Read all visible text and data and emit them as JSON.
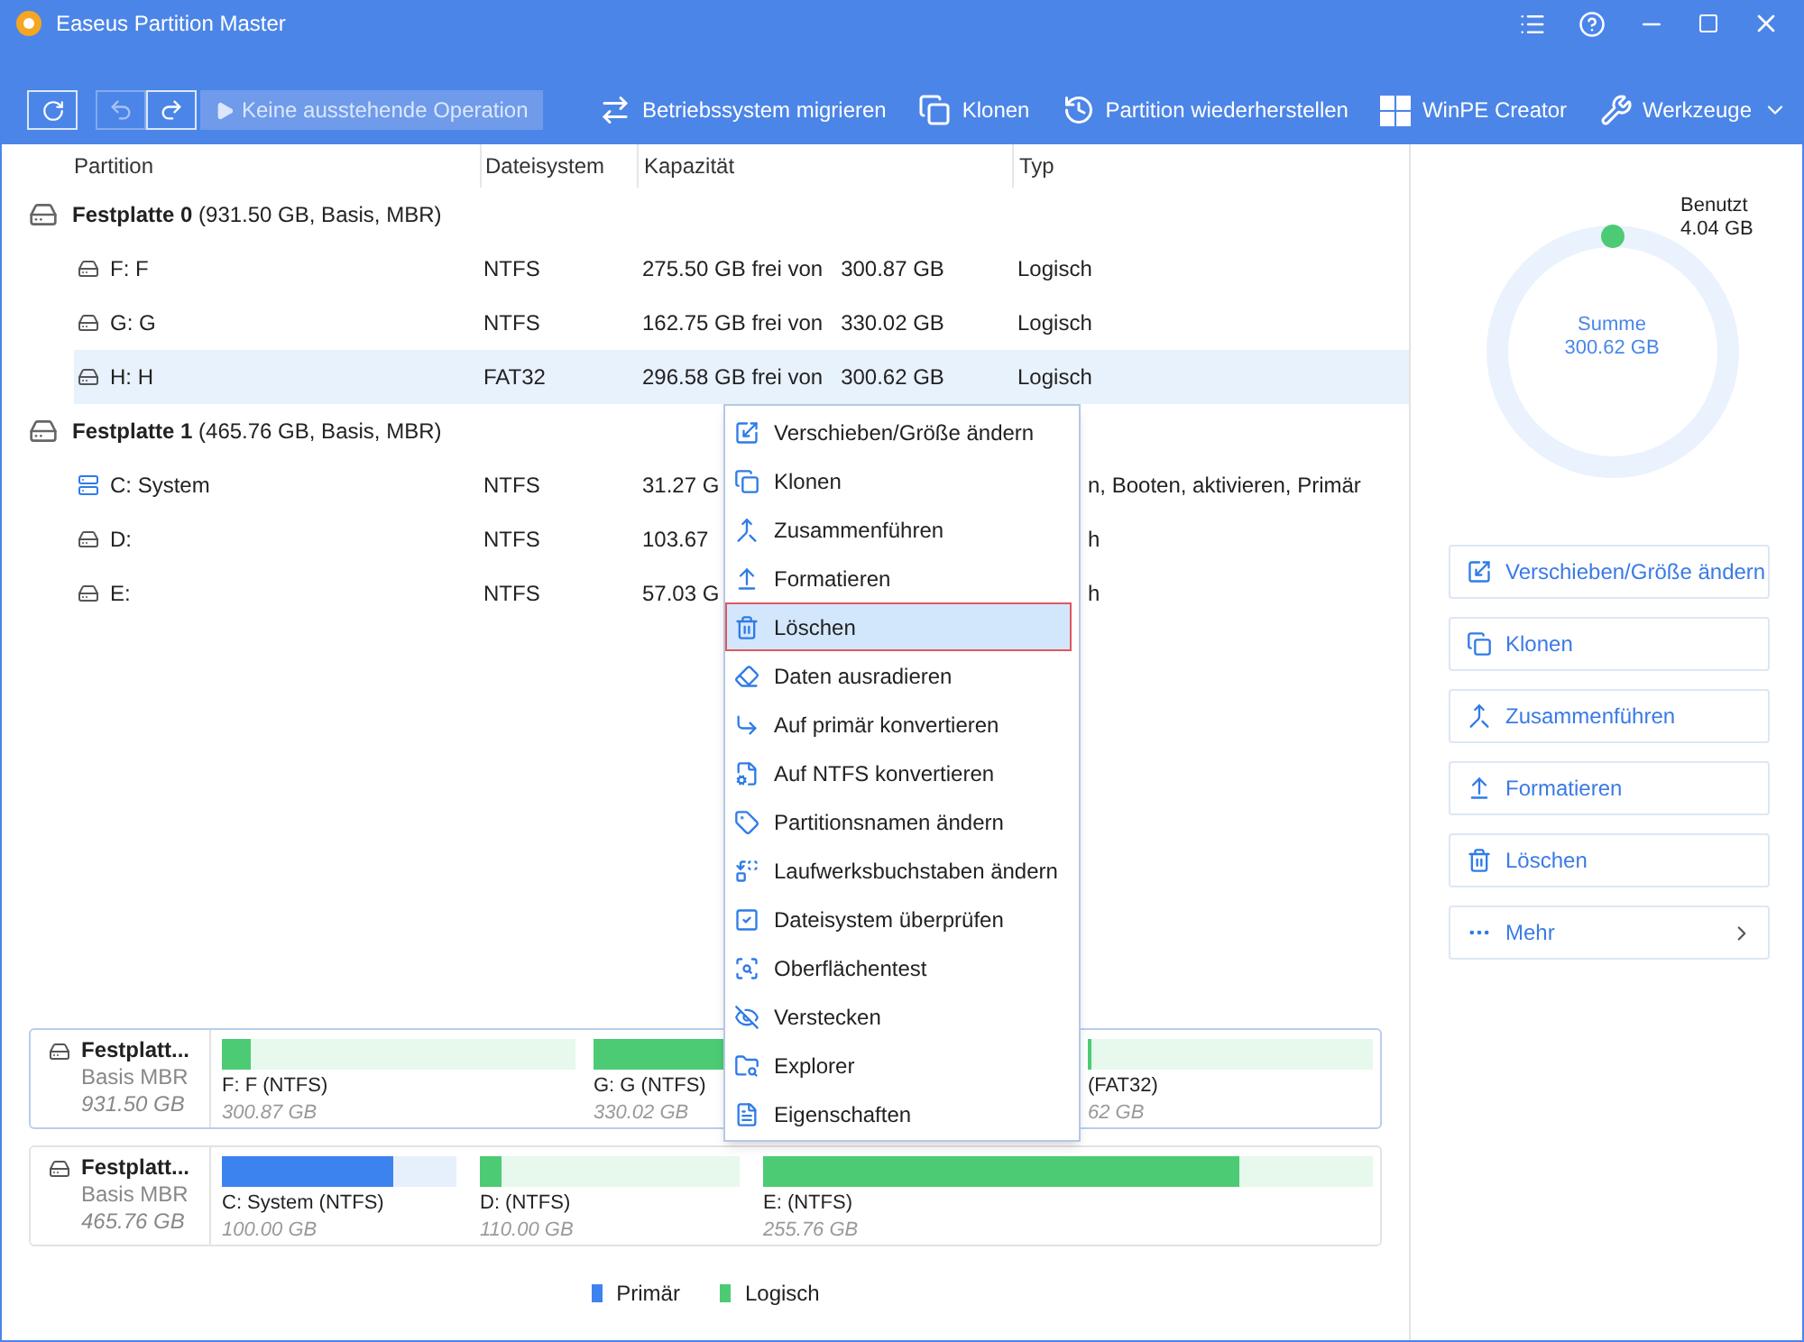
{
  "window": {
    "title": "Easeus Partition Master"
  },
  "toolbar": {
    "pending": {
      "label": "Keine ausstehende Operation",
      "disabled": true
    },
    "undo_disabled": true,
    "actions": [
      {
        "label": "Betriebssystem migrieren",
        "kind": "migrate"
      },
      {
        "label": "Klonen",
        "kind": "clone"
      },
      {
        "label": "Partition wiederherstellen",
        "kind": "recover"
      },
      {
        "label": "WinPE Creator",
        "kind": "winpe"
      },
      {
        "label": "Werkzeuge",
        "kind": "tools"
      }
    ]
  },
  "table": {
    "columns": [
      "Partition",
      "Dateisystem",
      "Kapazität",
      "Typ"
    ],
    "disks": [
      {
        "title": "**Festplatte 0** (931.50 GB, Basis, MBR)",
        "partitions": [
          {
            "name": "F: F",
            "kind": "drive",
            "filesystem": "NTFS",
            "free": "275.50 GB frei von",
            "total": "300.87 GB",
            "type": "Logisch",
            "selected": false
          },
          {
            "name": "G: G",
            "kind": "drive",
            "filesystem": "NTFS",
            "free": "162.75 GB frei von",
            "total": "330.02 GB",
            "type": "Logisch",
            "selected": false
          },
          {
            "name": "H: H",
            "kind": "drive",
            "filesystem": "FAT32",
            "free": "296.58 GB frei von",
            "total": "300.62 GB",
            "type": "Logisch",
            "selected": true
          }
        ]
      },
      {
        "title": "**Festplatte 1** (465.76 GB, Basis, MBR)",
        "partitions": [
          {
            "name": "C: System",
            "kind": "system",
            "filesystem": "NTFS",
            "free": "31.27 G",
            "type": "n, Booten, aktivieren, Primär",
            "selected": false
          },
          {
            "name": "D:",
            "kind": "drive",
            "filesystem": "NTFS",
            "free": "103.67",
            "type": "h",
            "selected": false
          },
          {
            "name": "E:",
            "kind": "drive",
            "filesystem": "NTFS",
            "free": "57.03 G",
            "type": "h",
            "selected": false
          }
        ]
      }
    ]
  },
  "context_menu": {
    "items": [
      {
        "label": "Verschieben/Größe ändern",
        "selected": false
      },
      {
        "label": "Klonen",
        "selected": false
      },
      {
        "label": "Zusammenführen",
        "selected": false
      },
      {
        "label": "Formatieren",
        "selected": false
      },
      {
        "label": "Löschen",
        "selected": true
      },
      {
        "label": "Daten ausradieren",
        "selected": false
      },
      {
        "label": "Auf primär konvertieren",
        "selected": false
      },
      {
        "label": "Auf NTFS konvertieren",
        "selected": false
      },
      {
        "label": "Partitionsnamen ändern",
        "selected": false
      },
      {
        "label": "Laufwerksbuchstaben ändern",
        "selected": false
      },
      {
        "label": "Dateisystem überprüfen",
        "selected": false
      },
      {
        "label": "Oberflächentest",
        "selected": false
      },
      {
        "label": "Verstecken",
        "selected": false
      },
      {
        "label": "Explorer",
        "selected": false
      },
      {
        "label": "Eigenschaften",
        "selected": false
      }
    ]
  },
  "disk_map": [
    {
      "name": "Festplatt...",
      "scheme": "Basis MBR",
      "size": "931.50 GB",
      "selected": true,
      "segments": [
        {
          "label": "F: F (NTFS)",
          "size": "300.87 GB",
          "kind": "logical",
          "level": 0.08
        },
        {
          "label": "G: G (NTFS)",
          "size": "330.02 GB",
          "kind": "logical",
          "level": 0.51
        },
        {
          "label": "(FAT32)",
          "size": "62 GB",
          "kind": "logical",
          "level": 0.01
        }
      ]
    },
    {
      "name": "Festplatt...",
      "scheme": "Basis MBR",
      "size": "465.76 GB",
      "selected": false,
      "segments": [
        {
          "label": "C: System (NTFS)",
          "size": "100.00 GB",
          "kind": "primary",
          "level": 0.73
        },
        {
          "label": "D:  (NTFS)",
          "size": "110.00 GB",
          "kind": "logical",
          "level": 0.08
        },
        {
          "label": "E:  (NTFS)",
          "size": "255.76 GB",
          "kind": "logical",
          "level": 0.78
        }
      ]
    }
  ],
  "legend": [
    {
      "label": "Primär",
      "color": "#3d83f0"
    },
    {
      "label": "Logisch",
      "color": "#4ccb74"
    }
  ],
  "side_panel": {
    "used_label": "Benutzt",
    "used": "4.04 GB",
    "total_label": "Summe",
    "total": "300.62 GB",
    "actions": [
      "Verschieben/Größe ändern",
      "Klonen",
      "Zusammenführen",
      "Formatieren",
      "Löschen",
      "Mehr"
    ]
  }
}
